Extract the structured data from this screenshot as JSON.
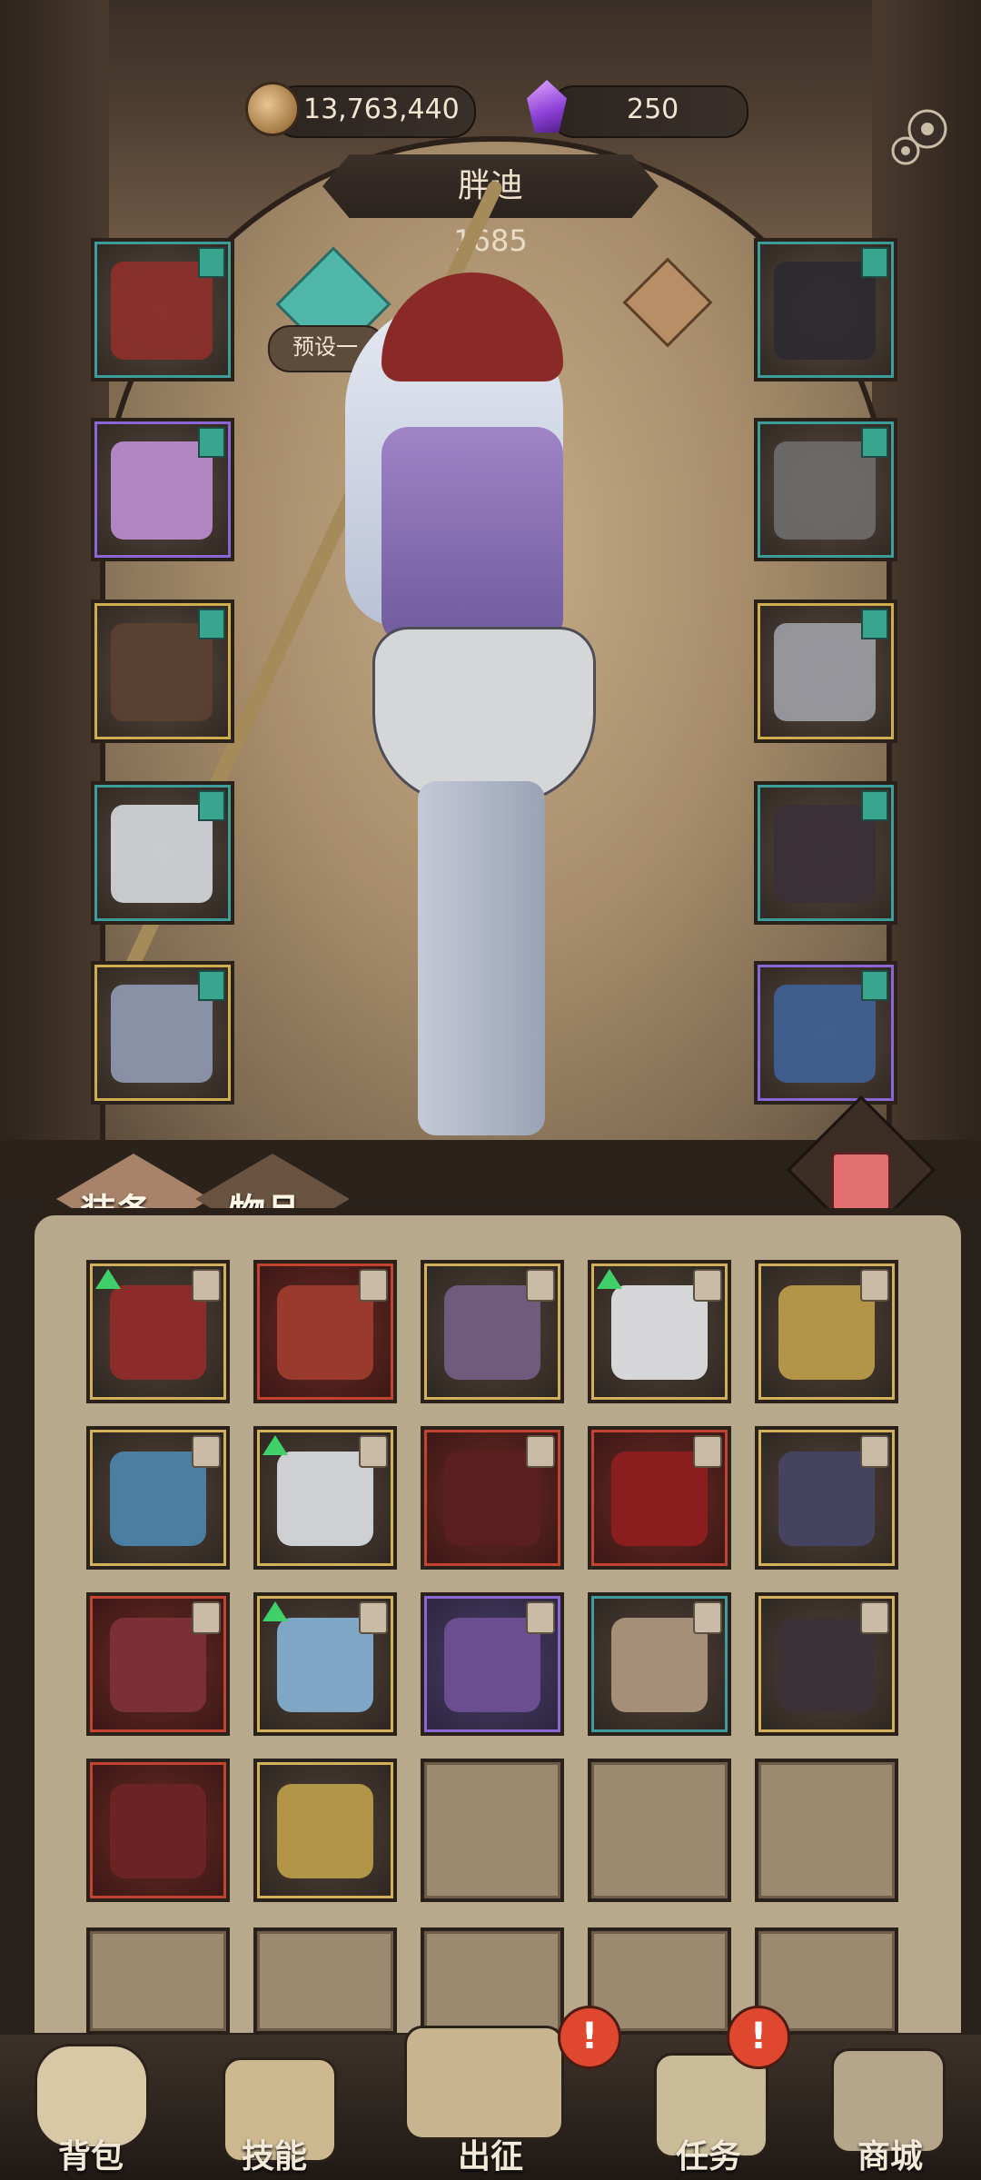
{
  "currency": {
    "gold_amount": "13,763,440",
    "gem_amount": "250"
  },
  "character": {
    "name": "胖迪",
    "power": "1685",
    "preset_label": "预设一"
  },
  "tabs": {
    "equipment": "装备",
    "items": "物品"
  },
  "equipment_slots": [
    {
      "slot": "head",
      "rarity": "teal",
      "icon": "hat-icon"
    },
    {
      "slot": "body",
      "rarity": "purple",
      "icon": "robe-icon"
    },
    {
      "slot": "gloves",
      "rarity": "gold",
      "icon": "gloves-icon"
    },
    {
      "slot": "pants",
      "rarity": "teal",
      "icon": "pants-icon"
    },
    {
      "slot": "boots",
      "rarity": "gold",
      "icon": "boots-icon"
    },
    {
      "slot": "amulet",
      "rarity": "teal",
      "icon": "necklace-icon"
    },
    {
      "slot": "ring-1",
      "rarity": "teal",
      "icon": "ring-icon"
    },
    {
      "slot": "ring-2",
      "rarity": "gold",
      "icon": "ring-icon"
    },
    {
      "slot": "weapon",
      "rarity": "teal",
      "icon": "staff-icon"
    },
    {
      "slot": "offhand",
      "rarity": "purple",
      "icon": "shield-icon"
    }
  ],
  "inventory": [
    {
      "rarity": "gold",
      "icon": "armor-icon",
      "upgrade": true
    },
    {
      "rarity": "red",
      "icon": "dagger-icon",
      "upgrade": false
    },
    {
      "rarity": "gold",
      "icon": "wand-icon",
      "upgrade": false
    },
    {
      "rarity": "gold",
      "icon": "feather-armor-icon",
      "upgrade": true
    },
    {
      "rarity": "gold",
      "icon": "lion-pendant-icon",
      "upgrade": false
    },
    {
      "rarity": "gold",
      "icon": "eye-amulet-icon",
      "upgrade": false
    },
    {
      "rarity": "gold",
      "icon": "feather-armor-icon",
      "upgrade": true
    },
    {
      "rarity": "red",
      "icon": "staff-icon",
      "upgrade": false
    },
    {
      "rarity": "red",
      "icon": "demon-mask-icon",
      "upgrade": false
    },
    {
      "rarity": "gold",
      "icon": "hood-icon",
      "upgrade": false
    },
    {
      "rarity": "red",
      "icon": "cloak-icon",
      "upgrade": false
    },
    {
      "rarity": "gold",
      "icon": "winged-boots-icon",
      "upgrade": true
    },
    {
      "rarity": "purple",
      "icon": "witch-hat-icon",
      "upgrade": false
    },
    {
      "rarity": "teal",
      "icon": "trousers-icon",
      "upgrade": false
    },
    {
      "rarity": "gold",
      "icon": "lightning-wand-icon",
      "upgrade": false
    },
    {
      "rarity": "red",
      "icon": "sword-icon",
      "upgrade": false
    },
    {
      "rarity": "gold",
      "icon": "lion-pendant-icon",
      "upgrade": false
    }
  ],
  "nav": {
    "backpack": "背包",
    "skills": "技能",
    "expedition": "出征",
    "quests": "任务",
    "shop": "商城",
    "alert_symbol": "!"
  },
  "colors": {
    "gold_frame": "#d0ad4e",
    "red_frame": "#c2432f",
    "purple_frame": "#8a67d4",
    "teal_frame": "#3e9c9a",
    "upgrade_arrow": "#3fd06a",
    "alert_badge": "#e0472f"
  }
}
